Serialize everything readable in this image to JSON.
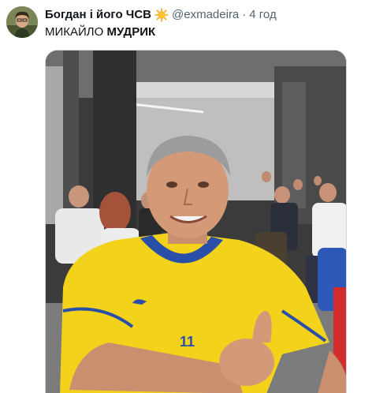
{
  "tweet": {
    "author": {
      "display_name": "Богдан і його ЧСВ",
      "badge_icon": "sun-emoji-icon",
      "handle": "@exmadeira"
    },
    "separator": "·",
    "timestamp": "4 год",
    "text_part1": "МИКАЙЛО ",
    "text_part2": "МУДРИК",
    "media": {
      "type": "photo",
      "jersey_number_visible": "11",
      "colors": {
        "jersey_yellow": "#f2d21b",
        "jersey_blue": "#2a4fa8"
      }
    }
  }
}
